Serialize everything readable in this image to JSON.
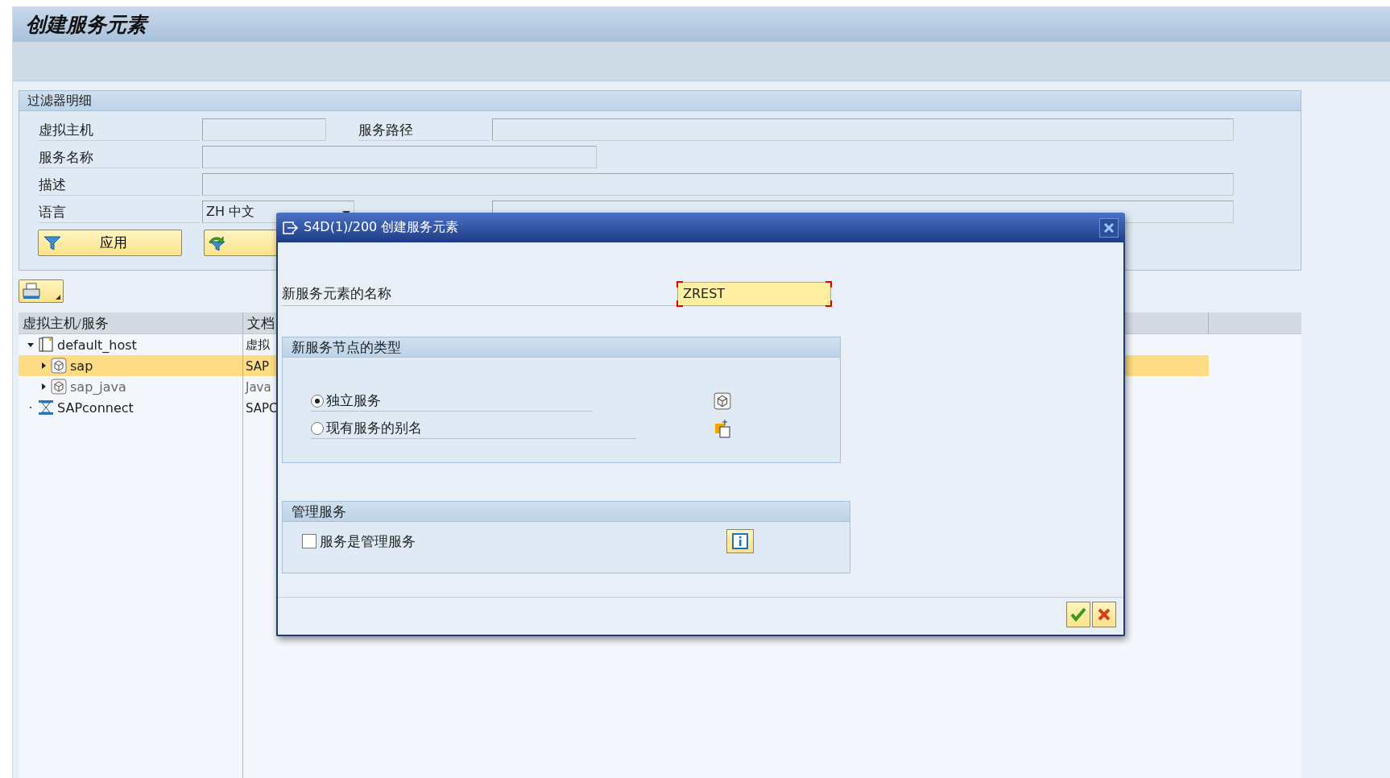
{
  "window": {
    "title": "创建服务元素"
  },
  "filter": {
    "title": "过滤器明细",
    "rows": [
      {
        "fields": [
          {
            "label": "虚拟主机",
            "kind": "text"
          },
          {
            "label": "服务路径",
            "kind": "text"
          }
        ]
      },
      {
        "fields": [
          {
            "label": "服务名称",
            "kind": "text"
          }
        ]
      },
      {
        "fields": [
          {
            "label": "描述",
            "kind": "text"
          }
        ]
      },
      {
        "fields": [
          {
            "label": "语言",
            "kind": "dropdown",
            "value": "ZH 中文"
          },
          {
            "kind": "text"
          }
        ]
      }
    ],
    "buttons": [
      {
        "label": "应用",
        "kind": "filter"
      },
      {
        "kind": "reset"
      }
    ]
  },
  "tree": {
    "columns": [
      "虚拟主机/服务",
      "文档"
    ],
    "rows": [
      {
        "name": "default_host",
        "kind": "host",
        "doc": "虚拟",
        "expanded": true,
        "selected": false,
        "active": true,
        "children": [
          {
            "name": "sap",
            "kind": "service",
            "doc": "SAP",
            "expanded": false,
            "selected": true,
            "active": true
          },
          {
            "name": "sap_java",
            "kind": "service",
            "doc": "Java",
            "expanded": false,
            "selected": false,
            "active": false
          }
        ]
      },
      {
        "name": "SAPconnect",
        "kind": "connect",
        "doc": "SAPC",
        "selected": false,
        "active": true
      }
    ]
  },
  "dialog": {
    "title": "S4D(1)/200 创建服务元素",
    "name_field": {
      "label": "新服务元素的名称",
      "value": "ZREST",
      "required": true
    },
    "node_type": {
      "title": "新服务节点的类型",
      "options": [
        {
          "label": "独立服务",
          "selected": true
        },
        {
          "label": "现有服务的别名",
          "selected": false
        }
      ]
    },
    "admin": {
      "title": "管理服务",
      "checkbox": {
        "label": "服务是管理服务",
        "checked": false
      }
    }
  }
}
